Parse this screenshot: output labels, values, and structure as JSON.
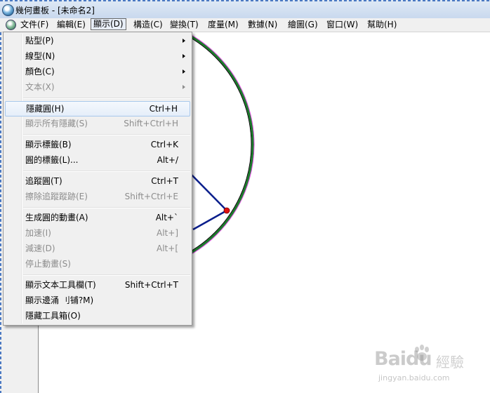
{
  "window": {
    "title": "幾何畫板 - [未命名2]"
  },
  "menubar": {
    "items": [
      {
        "label": "文件(F)"
      },
      {
        "label": "編輯(E)"
      },
      {
        "label": "顯示(D)"
      },
      {
        "label": "構造(C)"
      },
      {
        "label": "變換(T)"
      },
      {
        "label": "度量(M)"
      },
      {
        "label": "數據(N)"
      },
      {
        "label": "繪圖(G)"
      },
      {
        "label": "窗口(W)"
      },
      {
        "label": "幫助(H)"
      }
    ],
    "active_index": 2
  },
  "display_menu": {
    "items": [
      {
        "label": "點型(P)",
        "shortcut": "",
        "submenu": true,
        "disabled": false
      },
      {
        "label": "線型(N)",
        "shortcut": "",
        "submenu": true,
        "disabled": false
      },
      {
        "label": "顏色(C)",
        "shortcut": "",
        "submenu": true,
        "disabled": false
      },
      {
        "label": "文本(X)",
        "shortcut": "",
        "submenu": true,
        "disabled": true
      },
      {
        "label": "隱藏圓(H)",
        "shortcut": "Ctrl+H",
        "submenu": false,
        "disabled": false,
        "highlighted": true
      },
      {
        "label": "顯示所有隱藏(S)",
        "shortcut": "Shift+Ctrl+H",
        "submenu": false,
        "disabled": true
      },
      {
        "label": "顯示標籤(B)",
        "shortcut": "Ctrl+K",
        "submenu": false,
        "disabled": false
      },
      {
        "label": "圓的標籤(L)...",
        "shortcut": "Alt+/",
        "submenu": false,
        "disabled": false
      },
      {
        "label": "追蹤圓(T)",
        "shortcut": "Ctrl+T",
        "submenu": false,
        "disabled": false
      },
      {
        "label": "擦除追蹤蹤跡(E)",
        "shortcut": "Shift+Ctrl+E",
        "submenu": false,
        "disabled": true
      },
      {
        "label": "生成圓的動畫(A)",
        "shortcut": "Alt+`",
        "submenu": false,
        "disabled": false
      },
      {
        "label": "加速(I)",
        "shortcut": "Alt+]",
        "submenu": false,
        "disabled": true
      },
      {
        "label": "減速(D)",
        "shortcut": "Alt+[",
        "submenu": false,
        "disabled": true
      },
      {
        "label": "停止動畫(S)",
        "shortcut": "",
        "submenu": false,
        "disabled": true
      },
      {
        "label": "顯示文本工具欄(T)",
        "shortcut": "Shift+Ctrl+T",
        "submenu": false,
        "disabled": false
      },
      {
        "label": "顯示邊涌 刂铺?M)",
        "shortcut": "",
        "submenu": false,
        "disabled": false
      },
      {
        "label": "隱藏工具箱(O)",
        "shortcut": "",
        "submenu": false,
        "disabled": false
      }
    ]
  },
  "colors": {
    "circle_outer": "#e040e0",
    "circle_mid": "#1a7a2a",
    "circle_inner": "#000000",
    "segment": "#0a1e8c",
    "point": "#e01010",
    "highlight": "#a8c8ec"
  },
  "watermark": {
    "logo": "Baidu",
    "text": "經驗",
    "url": "jingyan.baidu.com"
  }
}
